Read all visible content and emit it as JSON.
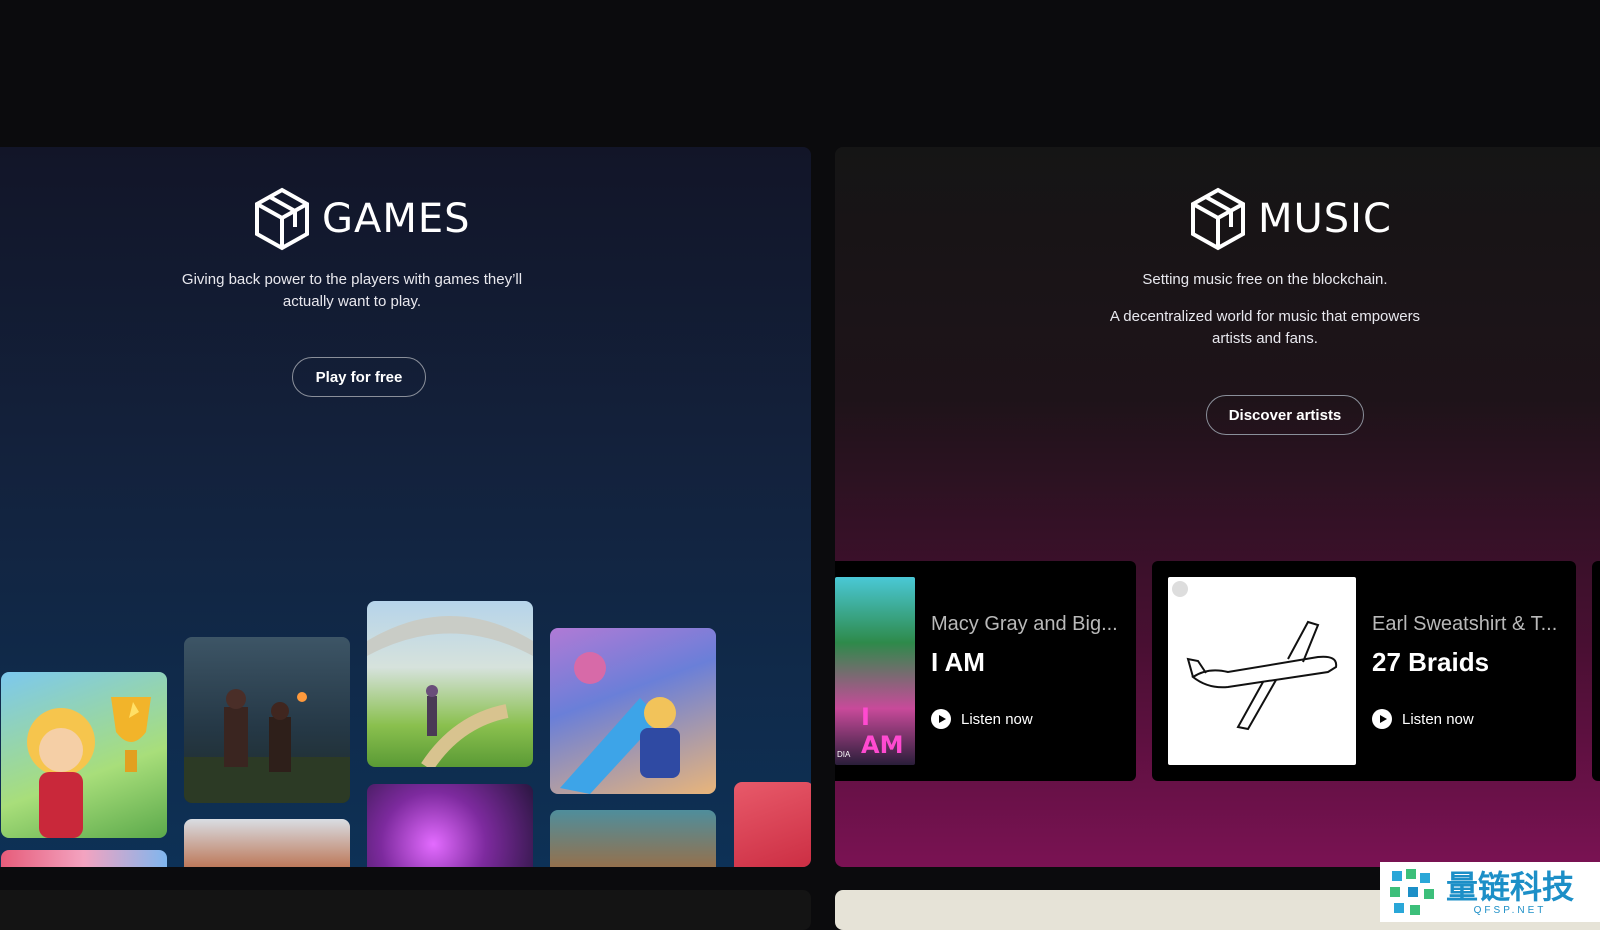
{
  "games": {
    "title": "GAMES",
    "description": "Giving back power to the players with games they’ll actually want to play.",
    "cta": "Play for free",
    "thumbnails": [
      "cowgirl-trophy",
      "dark-warriors",
      "meadow-ruins",
      "hero-battle",
      "forest-creature",
      "sky-warrior",
      "purple-energy",
      "green-beast",
      "red-creature",
      "pink-splash"
    ]
  },
  "music": {
    "title": "MUSIC",
    "tagline": "Setting music free on the blockchain.",
    "description": "A decentralized world for music that empowers artists and fans.",
    "cta": "Discover artists",
    "cards": [
      {
        "artist": "Macy Gray and Big...",
        "track": "I AM",
        "listen": "Listen now",
        "art_text": "I AM",
        "art_small": "DIA"
      },
      {
        "artist": "Earl Sweatshirt & T...",
        "track": "27 Braids",
        "listen": "Listen now"
      }
    ]
  },
  "watermark": {
    "name": "量链科技",
    "url": "QFSP.NET"
  },
  "colors": {
    "games_bg_top": "#121528",
    "games_bg_bottom": "#0d3156",
    "music_bg_top": "#151515",
    "music_bg_bottom": "#7a1253"
  }
}
